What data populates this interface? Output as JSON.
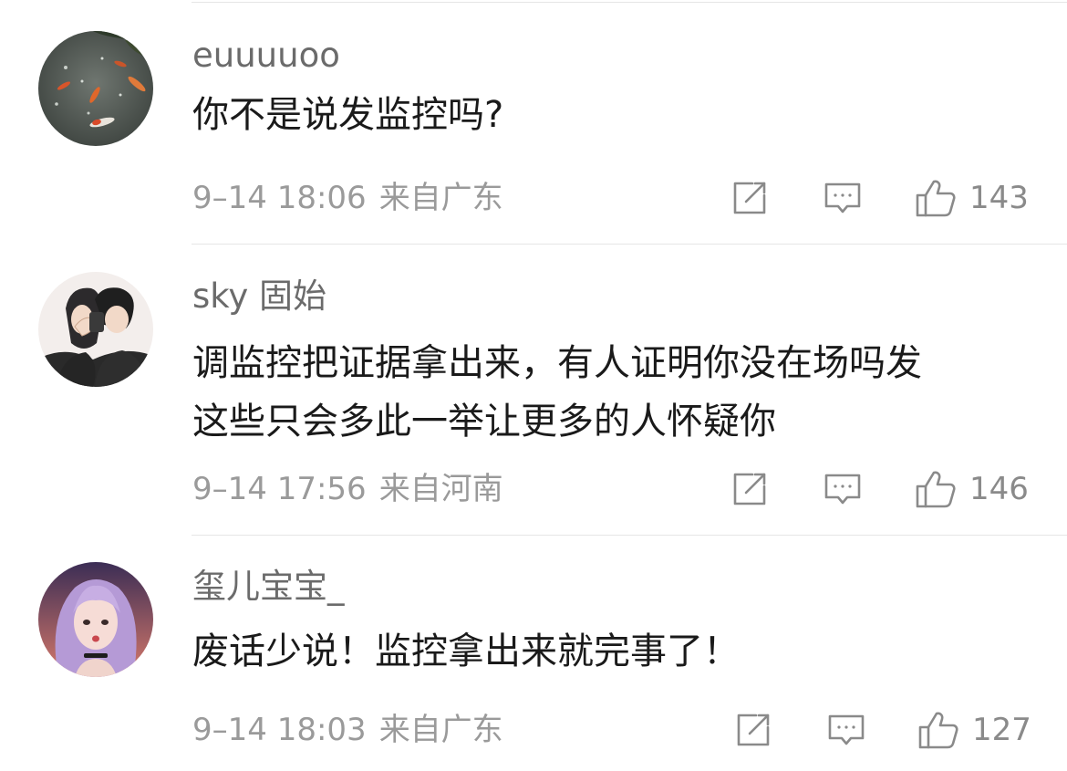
{
  "comments": [
    {
      "username": "euuuuoo",
      "lines": [
        "你不是说发监控吗?"
      ],
      "date": "9–14 18:06",
      "location": "来自广东",
      "likes": "143",
      "avatar_icon": "koi-pond-avatar-icon"
    },
    {
      "username": "sky 固始",
      "lines": [
        "调监控把证据拿出来，有人证明你没在场吗发",
        "这些只会多此一举让更多的人怀疑你"
      ],
      "date": "9–14 17:56",
      "location": "来自河南",
      "likes": "146",
      "avatar_icon": "couple-illustration-avatar-icon"
    },
    {
      "username": "玺儿宝宝_",
      "lines": [
        "废话少说！监控拿出来就完事了！"
      ],
      "date": "9–14 18:03",
      "location": "来自广东",
      "likes": "127",
      "avatar_icon": "girl-portrait-avatar-icon"
    }
  ],
  "icons": {
    "share": "share-icon",
    "reply": "reply-icon",
    "like": "thumbs-up-icon"
  },
  "colors": {
    "username": "#6b6b6b",
    "content": "#1a1a1a",
    "meta": "#9a9a9a",
    "icon": "#8a8a8a",
    "divider": "#e6e6e6"
  }
}
